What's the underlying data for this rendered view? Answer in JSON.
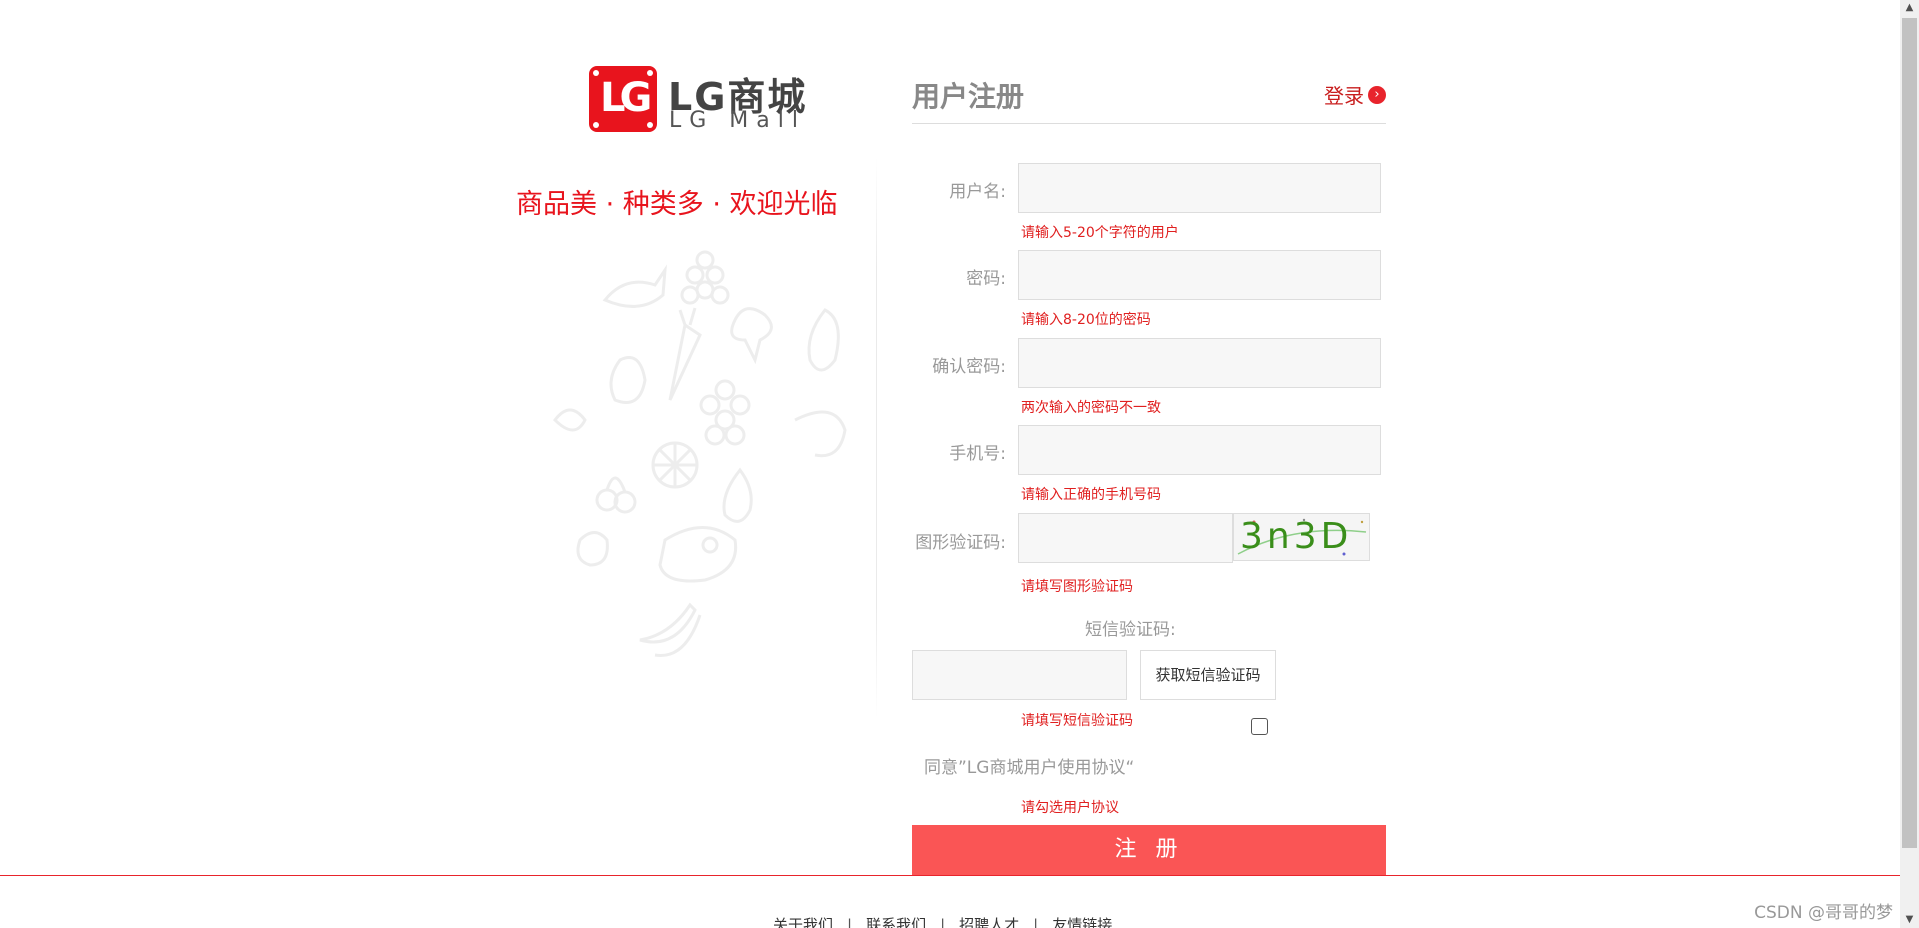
{
  "brand": {
    "logo_letters": "LG",
    "title": "LG商城",
    "subtitle": "LG Mall",
    "slogan": "商品美 · 种类多 · 欢迎光临"
  },
  "form": {
    "title": "用户注册",
    "login_link": "登录",
    "login_arrow": "›",
    "fields": {
      "username": {
        "label": "用户名:",
        "hint": "请输入5-20个字符的用户"
      },
      "password": {
        "label": "密码:",
        "hint": "请输入8-20位的密码"
      },
      "confirm_password": {
        "label": "确认密码:",
        "hint": "两次输入的密码不一致"
      },
      "phone": {
        "label": "手机号:",
        "hint": "请输入正确的手机号码"
      },
      "captcha": {
        "label": "图形验证码:",
        "hint": "请填写图形验证码",
        "image_text": "3n3D"
      },
      "sms": {
        "label": "短信验证码:",
        "button": "获取短信验证码",
        "hint": "请填写短信验证码"
      }
    },
    "agreement": {
      "text": "同意”LG商城用户使用协议“",
      "hint": "请勾选用户协议",
      "checked": false
    },
    "submit": "注 册"
  },
  "footer": {
    "links": [
      "关于我们",
      "联系我们",
      "招聘人才",
      "友情链接"
    ],
    "separator": "|"
  },
  "watermark": "CSDN @哥哥的梦",
  "colors": {
    "brand_red": "#e8141d",
    "hint_red": "#e02020",
    "button_red": "#fa5555"
  }
}
